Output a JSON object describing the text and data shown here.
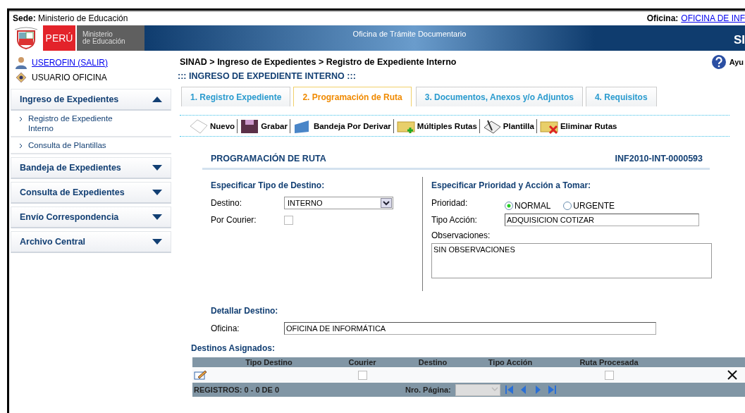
{
  "header": {
    "sede_label": "Sede:",
    "sede_value": "Ministerio de Educación",
    "oficina_label": "Oficina:",
    "oficina_link": "OFICINA DE INF"
  },
  "banner": {
    "country": "PERÚ",
    "ministry": [
      "Ministerio",
      "de Educación"
    ],
    "title": "Oficina de Trámite Documentario",
    "brand": "SI"
  },
  "user": {
    "link": "USEROFIN (SALIR)",
    "role": "USUARIO OFICINA"
  },
  "sidebar": {
    "sections": [
      {
        "title": "Ingreso de Expedientes",
        "expanded": true,
        "children": [
          {
            "label": "Registro de Expediente Interno"
          },
          {
            "label": "Consulta de Plantillas"
          }
        ]
      },
      {
        "title": "Bandeja de Expedientes",
        "expanded": false
      },
      {
        "title": "Consulta de Expedientes",
        "expanded": false
      },
      {
        "title": "Envío Correspondencia",
        "expanded": false
      },
      {
        "title": "Archivo Central",
        "expanded": false
      }
    ]
  },
  "breadcrumb": "SINAD > Ingreso de Expedientes > Registro de Expediente Interno",
  "help": "Ayu",
  "page_title": "::: INGRESO DE EXPEDIENTE INTERNO :::",
  "tabs": [
    {
      "label": "1. Registro Expediente",
      "selected": false
    },
    {
      "label": "2. Programación de Ruta",
      "selected": true
    },
    {
      "label": "3. Documentos, Anexos y/o Adjuntos",
      "selected": false
    },
    {
      "label": "4. Requisitos",
      "selected": false
    }
  ],
  "toolbar": [
    {
      "kind": "new",
      "label": "Nuevo"
    },
    {
      "kind": "save",
      "label": "Grabar"
    },
    {
      "kind": "tray",
      "label": "Bandeja Por Derivar"
    },
    {
      "kind": "multi",
      "label": "Múltiples Rutas"
    },
    {
      "kind": "template",
      "label": "Plantilla"
    },
    {
      "kind": "delete",
      "label": "Eliminar Rutas"
    }
  ],
  "form": {
    "title": "PROGRAMACIÓN DE RUTA",
    "code": "INF2010-INT-0000593",
    "destination": {
      "heading": "Especificar Tipo de Destino:",
      "destino_label": "Destino:",
      "destino_value": "INTERNO",
      "courier_label": "Por Courier:",
      "courier_checked": false
    },
    "priority": {
      "heading": "Especificar Prioridad y Acción a Tomar:",
      "priority_label": "Prioridad:",
      "options": [
        {
          "label": "NORMAL",
          "selected": true
        },
        {
          "label": "URGENTE",
          "selected": false
        }
      ],
      "action_label": "Tipo Acción:",
      "action_value": "ADQUISICION COTIZAR",
      "notes_label": "Observaciones:",
      "notes_value": "SIN OBSERVACIONES"
    },
    "detail": {
      "heading": "Detallar Destino:",
      "office_label": "Oficina:",
      "office_value": "OFICINA DE INFORMÁTICA"
    }
  },
  "grid": {
    "title": "Destinos Asignados:",
    "columns": [
      "Tipo Destino",
      "Courier",
      "Destino",
      "Tipo Acción",
      "Ruta Procesada"
    ],
    "rows": [
      {
        "courier": false,
        "processed": false
      }
    ],
    "footer": {
      "records": "REGISTROS: 0 - 0 DE 0",
      "page_label": "Nro. Página:"
    }
  }
}
